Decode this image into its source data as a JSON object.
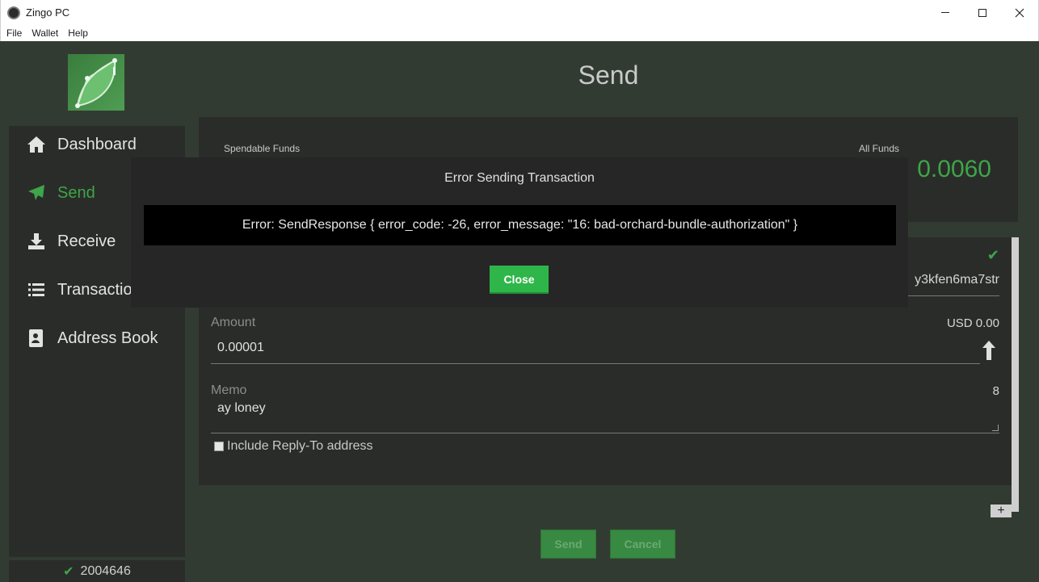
{
  "window": {
    "title": "Zingo PC"
  },
  "menu": [
    "File",
    "Wallet",
    "Help"
  ],
  "sidebar": {
    "items": [
      {
        "label": "Dashboard",
        "icon": "home-icon"
      },
      {
        "label": "Send",
        "icon": "send-icon",
        "active": true
      },
      {
        "label": "Receive",
        "icon": "download-icon"
      },
      {
        "label": "Transactio",
        "icon": "list-icon"
      },
      {
        "label": "Address Book",
        "icon": "contact-book-icon"
      }
    ],
    "status_height": "2004646"
  },
  "page": {
    "title": "Send"
  },
  "balances": {
    "spendable_label": "Spendable Funds",
    "all_label": "All Funds",
    "all_value": "0.0060"
  },
  "form": {
    "address_value": "y3kfen6ma7str",
    "amount_label": "Amount",
    "amount_value": "0.00001",
    "usd_value": "USD 0.00",
    "memo_label": "Memo",
    "memo_value": "ay loney",
    "memo_count": "8",
    "reply_to_label": "Include Reply-To address"
  },
  "actions": {
    "send": "Send",
    "cancel": "Cancel",
    "add": "+"
  },
  "modal": {
    "title": "Error Sending Transaction",
    "message": "Error: SendResponse { error_code: -26, error_message: \"16: bad-orchard-bundle-authorization\" }",
    "close": "Close"
  },
  "colors": {
    "accent": "#3ea548",
    "background": "#323b32",
    "panel": "#2a2c2a"
  }
}
